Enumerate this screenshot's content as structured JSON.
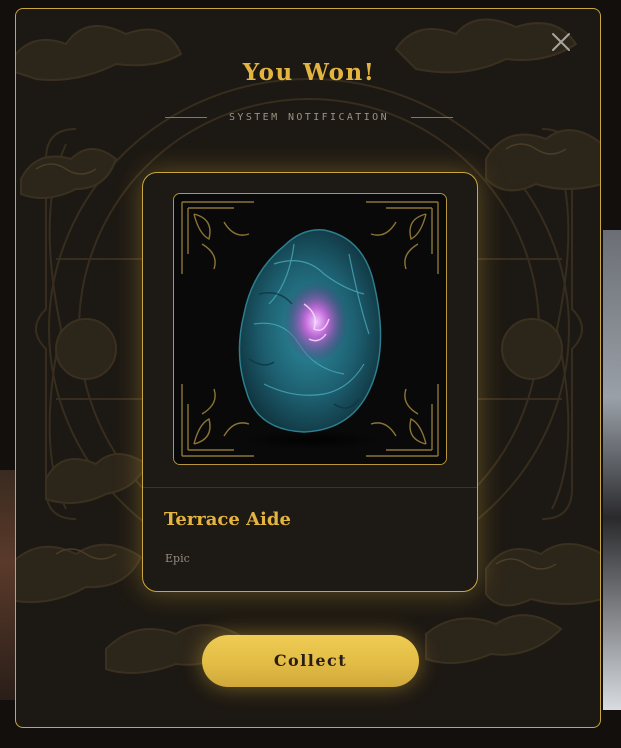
{
  "modal": {
    "title": "You Won!",
    "subtitle": "SYSTEM NOTIFICATION",
    "close_icon": "close-icon"
  },
  "reward": {
    "item_name": "Terrace Aide",
    "rarity": "Epic",
    "image_icon": "crystal-gem-icon"
  },
  "actions": {
    "collect_label": "Collect"
  },
  "colors": {
    "accent_gold": "#e3b43f",
    "border_gold": "#c9a640",
    "panel_bg": "#1c1813",
    "card_bg": "#1d1915",
    "button_gold": "#e2bc45",
    "muted_text": "#948b7c"
  }
}
